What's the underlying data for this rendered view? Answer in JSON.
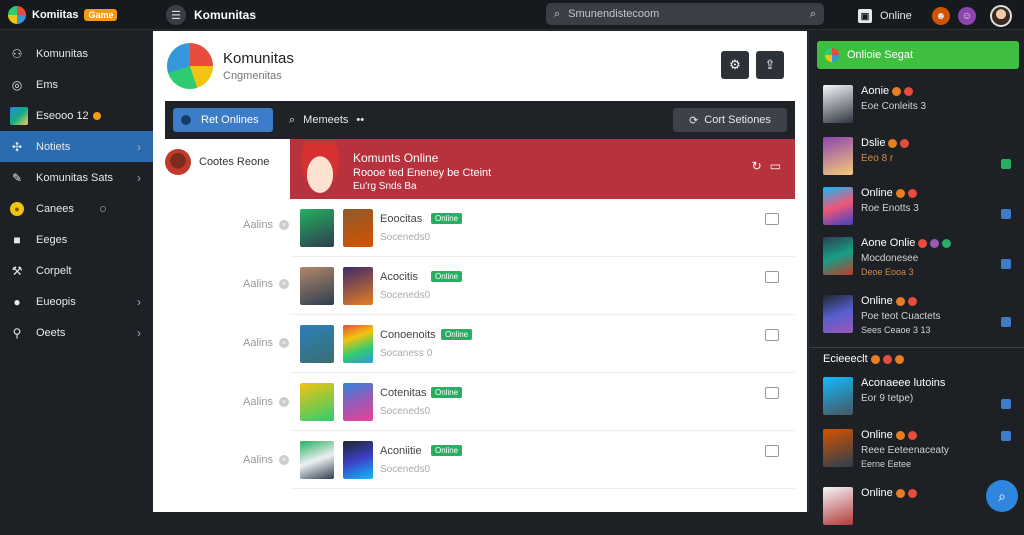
{
  "app": {
    "name": "Komiitas",
    "badge": "Game"
  },
  "top": {
    "title": "Komunitas",
    "search_placeholder": "Smunendistecoom",
    "status_label": "Online"
  },
  "sidebar": {
    "items": [
      {
        "label": "Komunitas",
        "icon": "users-icon"
      },
      {
        "label": "Ems",
        "icon": "chat-icon"
      },
      {
        "label": "Eseooo 12",
        "icon": "image-icon"
      },
      {
        "label": "Notiets",
        "icon": "puzzle-icon",
        "active": true
      },
      {
        "label": "Komunitas Sats",
        "icon": "brush-icon"
      },
      {
        "label": "Canees",
        "icon": "coin-icon"
      },
      {
        "label": "Eeges",
        "icon": "square-icon"
      },
      {
        "label": "Corpelt",
        "icon": "wrench-icon"
      },
      {
        "label": "Eueopis",
        "icon": "user-icon"
      },
      {
        "label": "Oeets",
        "icon": "pin-icon"
      }
    ]
  },
  "community": {
    "name": "Komunitas",
    "subtitle": "Cngmenitas"
  },
  "toolbar": {
    "primary": "Ret Onlines",
    "link": "Memeets",
    "right": "Cort Setiones"
  },
  "left_list": {
    "first": "Cootes Reone",
    "rows": [
      "Aalins",
      "Aalins",
      "Aalins",
      "Aalins",
      "Aalins"
    ]
  },
  "feed": {
    "top": {
      "title": "Komunts Online",
      "line2": "Roooe ted Eneney be Cteint",
      "line3": "Eu'rg Snds Ba"
    },
    "rows": [
      {
        "name": "Eoocitas",
        "badge": "Online",
        "sub": "Soceneds0"
      },
      {
        "name": "Acocitis",
        "badge": "Online",
        "sub": "Soceneds0"
      },
      {
        "name": "Conoenoits",
        "badge": "Online",
        "sub": "Socaness 0"
      },
      {
        "name": "Cotenitas",
        "badge": "Online",
        "sub": "Soceneds0"
      },
      {
        "name": "Aconiitie",
        "badge": "Online",
        "sub": "Soceneds0"
      }
    ]
  },
  "right_panel": {
    "header": "Onlioie Segat",
    "items": [
      {
        "l1": "Aonie",
        "l2": "Eoe Conleits 3",
        "l3": ""
      },
      {
        "l1": "Dslie",
        "l2": "Eeo 8 r",
        "l3": ""
      },
      {
        "l1": "Online",
        "l2": "Roe Enotts 3",
        "l3": ""
      },
      {
        "l1": "Aone Onlie",
        "l2": "Mocdonesee",
        "l3": "Deoe Eooa 3"
      },
      {
        "l1": "Online",
        "l2": "Poe teot Cuactets",
        "l3": "Sees Ceaoe 3 13"
      }
    ],
    "section": "Ecieeeclt",
    "items2": [
      {
        "l1": "Aconaeee lutoins",
        "l2": "Eor 9 tetpe)",
        "l3": ""
      },
      {
        "l1": "Online",
        "l2": "Reee Eeteenaceaty",
        "l3": "Eerne Eetee"
      },
      {
        "l1": "Online",
        "l2": "",
        "l3": ""
      }
    ]
  }
}
